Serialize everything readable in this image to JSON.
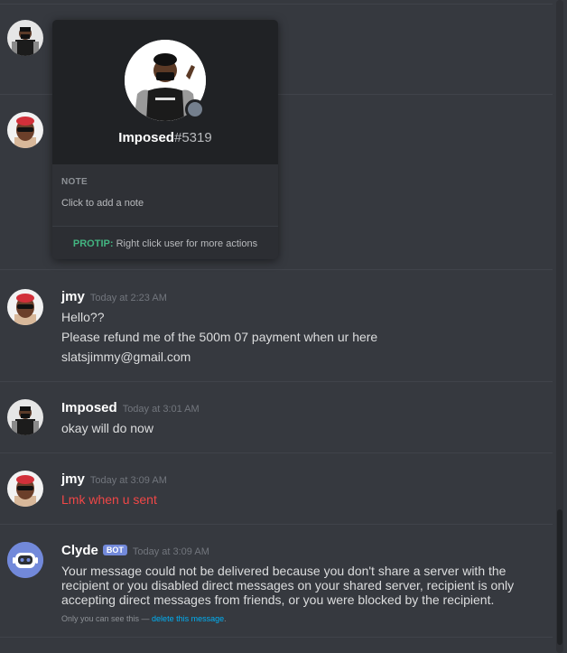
{
  "popout": {
    "username": "Imposed",
    "discriminator": "#5319",
    "note_label": "NOTE",
    "note_placeholder": "Click to add a note",
    "protip_label": "PROTIP:",
    "protip_text": " Right click user for more actions"
  },
  "messages": [
    {
      "author": "jmy",
      "timestamp": "Today at 2:23 AM",
      "lines": [
        "Hello??",
        "Please refund me of the 500m 07 payment when ur here",
        "slatsjimmy@gmail.com"
      ]
    },
    {
      "author": "Imposed",
      "timestamp": "Today at 3:01 AM",
      "lines": [
        "okay will do now"
      ]
    },
    {
      "author": "jmy",
      "timestamp": "Today at 3:09 AM",
      "lines": [
        "Lmk when u sent"
      ]
    },
    {
      "author": "Clyde",
      "badge": "BOT",
      "timestamp": "Today at 3:09 AM",
      "text": "Your message could not be delivered because you don't share a server with the recipient or you disabled direct messages on your shared server, recipient is only accepting direct messages from friends, or you were blocked by the recipient.",
      "ephemeral_prefix": "Only you can see this — ",
      "ephemeral_link": "delete this message",
      "ephemeral_suffix": "."
    }
  ],
  "colors": {
    "background": "#36393f",
    "popout": "#2f3136",
    "popout_header": "#202225",
    "protip": "#43b581",
    "error_text": "#f04747",
    "bot_badge": "#7289da",
    "link": "#00b0f4",
    "clyde": "#7289da"
  },
  "icons": {
    "clyde_avatar": "clyde-bot-icon",
    "status": "offline-status-icon"
  }
}
